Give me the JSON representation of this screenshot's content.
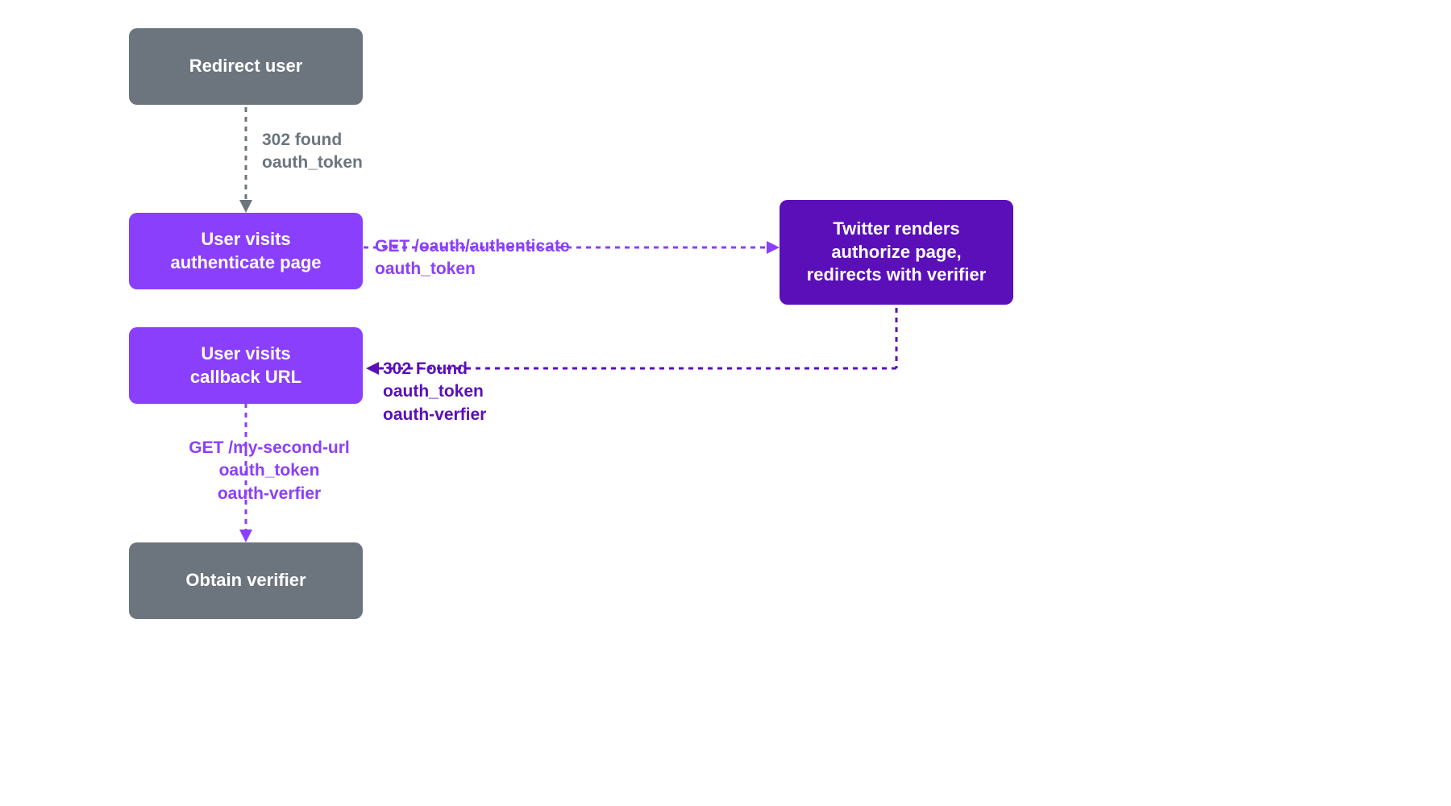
{
  "colors": {
    "gray": "#6c757d",
    "purple_light": "#8a3ffc",
    "purple_dark": "#5a0fb8"
  },
  "boxes": {
    "redirect_user": "Redirect user",
    "user_visits_auth_line1": "User visits",
    "user_visits_auth_line2": "authenticate page",
    "twitter_renders_line1": "Twitter renders",
    "twitter_renders_line2": "authorize page,",
    "twitter_renders_line3": "redirects with verifier",
    "user_visits_callback_line1": "User visits",
    "user_visits_callback_line2": "callback URL",
    "obtain_verifier": "Obtain verifier"
  },
  "labels": {
    "l1_line1": "302 found",
    "l1_line2": "oauth_token",
    "l2_line1": "GET /oauth/authenticate",
    "l2_line2": "oauth_token",
    "l3_line1": "302 Found",
    "l3_line2": "oauth_token",
    "l3_line3": "oauth-verfier",
    "l4_line1": "GET /my-second-url",
    "l4_line2": "oauth_token",
    "l4_line3": "oauth-verfier"
  }
}
